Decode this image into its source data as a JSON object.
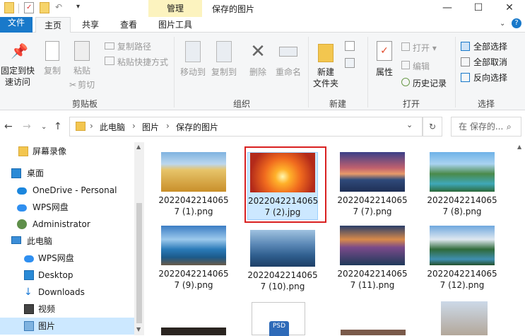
{
  "titlebar": {
    "context_tab": "管理",
    "title": "保存的图片",
    "minimize": "—",
    "maximize": "☐",
    "close": "✕"
  },
  "tabs": {
    "file": "文件",
    "home": "主页",
    "share": "共享",
    "view": "查看",
    "picture_tools": "图片工具"
  },
  "ribbon": {
    "pin": "固定到快速访问",
    "pin_l1": "固定到快",
    "pin_l2": "速访问",
    "copy": "复制",
    "paste": "粘贴",
    "copy_path": "复制路径",
    "paste_shortcut": "粘贴快捷方式",
    "cut": "剪切",
    "clipboard": "剪贴板",
    "move_to": "移动到",
    "copy_to": "复制到",
    "delete": "删除",
    "rename": "重命名",
    "organize": "组织",
    "new_folder_l1": "新建",
    "new_folder_l2": "文件夹",
    "new": "新建",
    "properties": "属性",
    "open": "打开",
    "edit": "编辑",
    "history": "历史记录",
    "open_group": "打开",
    "select_all": "全部选择",
    "select_none": "全部取消",
    "invert": "反向选择",
    "select_group": "选择"
  },
  "address": {
    "path": [
      "此电脑",
      "图片",
      "保存的图片"
    ],
    "search_placeholder": "在 保存的..."
  },
  "nav": [
    {
      "label": "屏幕录像"
    },
    {
      "label": "桌面"
    },
    {
      "label": "OneDrive - Personal"
    },
    {
      "label": "WPS网盘"
    },
    {
      "label": "Administrator"
    },
    {
      "label": "此电脑"
    },
    {
      "label": "WPS网盘"
    },
    {
      "label": "Desktop"
    },
    {
      "label": "Downloads"
    },
    {
      "label": "视频"
    },
    {
      "label": "图片"
    }
  ],
  "files": [
    {
      "l1": "2022042214065",
      "l2": "7 (1).png"
    },
    {
      "l1": "2022042214065",
      "l2": "7 (2).jpg"
    },
    {
      "l1": "2022042214065",
      "l2": "7 (7).png"
    },
    {
      "l1": "2022042214065",
      "l2": "7 (8).png"
    },
    {
      "l1": "2022042214065",
      "l2": "7 (9).png"
    },
    {
      "l1": "2022042214065",
      "l2": "7 (10).png"
    },
    {
      "l1": "2022042214065",
      "l2": "7 (11).png"
    },
    {
      "l1": "2022042214065",
      "l2": "7 (12).png"
    }
  ],
  "psd_label": "PSD",
  "colors": {
    "accent": "#1979ca",
    "context_tab": "#fcf3bf",
    "highlight": "#d92020"
  }
}
